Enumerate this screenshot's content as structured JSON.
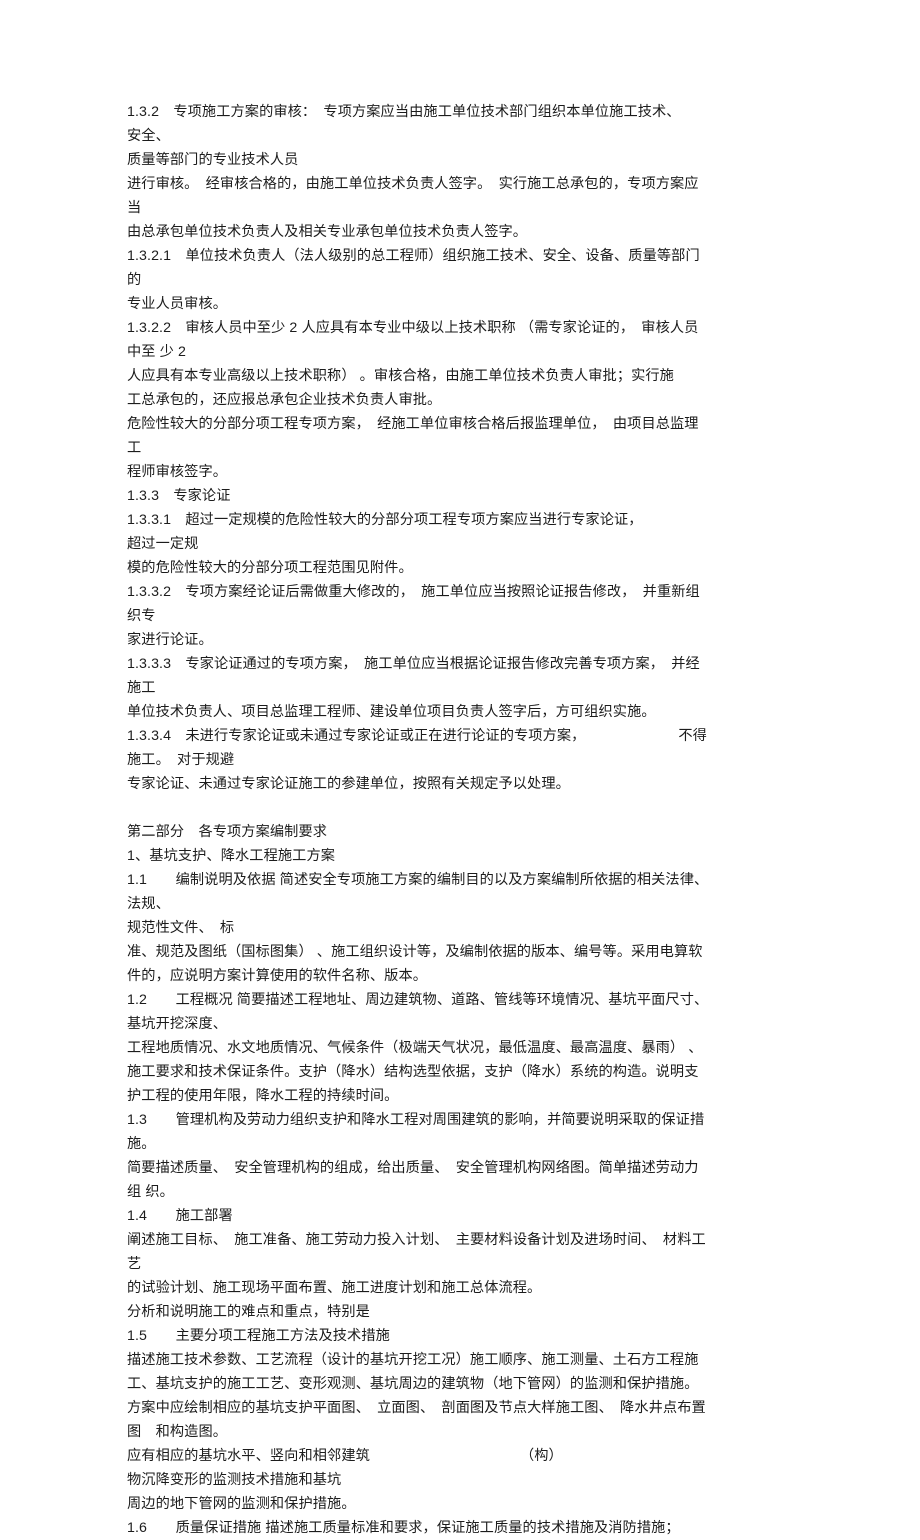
{
  "document": {
    "title": "专项施工方案编制要求",
    "page_background": "#ffffff",
    "text_color": "#1c1c1c",
    "paragraphs": [
      {
        "id": "p-1-3-2",
        "name": "paragraph-1-3-2",
        "text": "1.3.2　专项施工方案的审核：　专项方案应当由施工单位技术部门组织本单位施工技术、　　　　安全、\n质量等部门的专业技术人员"
      },
      {
        "id": "p-1-3-2-cont-1",
        "name": "paragraph-1-3-2-continued-1",
        "text": "进行审核。　经审核合格的，由施工单位技术负责人签字。　实行施工总承包的，专项方案应当"
      },
      {
        "id": "p-1-3-2-cont-2",
        "name": "paragraph-1-3-2-continued-2",
        "text": "由总承包单位技术负责人及相关专业承包单位技术负责人签字。"
      },
      {
        "id": "p-1-3-2-1",
        "name": "paragraph-1-3-2-1",
        "text": "1.3.2.1　单位技术负责人（法人级别的总工程师）组织施工技术、安全、设备、质量等部门的\n专业人员审核。"
      },
      {
        "id": "p-1-3-2-2",
        "name": "paragraph-1-3-2-2",
        "text": "1.3.2.2　审核人员中至少 2 人应具有本专业中级以上技术职称 （需专家论证的，　审核人员中至 少 2\n人应具有本专业高级以上技术职称） 。审核合格，由施工单位技术负责人审批；实行施\n工总承包的，还应报总承包企业技术负责人审批。"
      },
      {
        "id": "p-hazard",
        "name": "paragraph-hazardous-subproject",
        "text": "危险性较大的分部分项工程专项方案，　经施工单位审核合格后报监理单位，　由项目总监理工\n程师审核签字。"
      },
      {
        "id": "p-1-3-3",
        "name": "heading-1-3-3",
        "text": "1.3.3　专家论证"
      },
      {
        "id": "p-1-3-3-1",
        "name": "paragraph-1-3-3-1",
        "text": "1.3.3.1　超过一定规模的危险性较大的分部分项工程专项方案应当进行专家论证，　　　　　　　超过一定规\n模的危险性较大的分部分项工程范围见附件。"
      },
      {
        "id": "p-1-3-3-2",
        "name": "paragraph-1-3-3-2",
        "text": "1.3.3.2　专项方案经论证后需做重大修改的，　施工单位应当按照论证报告修改，　并重新组织专\n家进行论证。"
      },
      {
        "id": "p-1-3-3-3",
        "name": "paragraph-1-3-3-3",
        "text": "1.3.3.3　专家论证通过的专项方案，　施工单位应当根据论证报告修改完善专项方案，　并经施工\n单位技术负责人、项目总监理工程师、建设单位项目负责人签字后，方可组织实施。"
      },
      {
        "id": "p-1-3-3-4",
        "name": "paragraph-1-3-3-4",
        "text": "1.3.3.4　未进行专家论证或未通过专家论证或正在进行论证的专项方案，　　　　　　　不得施工。　对于规避\n专家论证、未通过专家论证施工的参建单位，按照有关规定予以处理。"
      },
      {
        "id": "spacer-1",
        "name": "blank-line-spacer",
        "text": ""
      },
      {
        "id": "p-part-2",
        "name": "heading-part-two",
        "text": "第二部分　各专项方案编制要求"
      },
      {
        "id": "p-sec-1",
        "name": "heading-section-1",
        "text": "1、基坑支护、降水工程施工方案"
      },
      {
        "id": "p-1-1",
        "name": "paragraph-1-1",
        "text": "1.1　　编制说明及依据 简述安全专项施工方案的编制目的以及方案编制所依据的相关法律、　法规、\n规范性文件、　标"
      },
      {
        "id": "p-1-1-cont",
        "name": "paragraph-1-1-continued",
        "text": "准、规范及图纸（国标图集） 、施工组织设计等，及编制依据的版本、编号等。采用电算软\n件的，应说明方案计算使用的软件名称、版本。"
      },
      {
        "id": "p-1-2",
        "name": "paragraph-1-2",
        "text": "1.2　　工程概况 简要描述工程地址、周边建筑物、道路、管线等环境情况、基坑平面尺寸、基坑开挖深度、\n工程地质情况、水文地质情况、气候条件（极端天气状况，最低温度、最高温度、暴雨） 、\n施工要求和技术保证条件。支护（降水）结构选型依据，支护（降水）系统的构造。说明支\n护工程的使用年限，降水工程的持续时间。"
      },
      {
        "id": "p-1-3",
        "name": "paragraph-1-3",
        "text": "1.3　　管理机构及劳动力组织支护和降水工程对周围建筑的影响，并简要说明采取的保证措 施。\n简要描述质量、　安全管理机构的组成，给出质量、　安全管理机构网络图。简单描述劳动力组 织。"
      },
      {
        "id": "p-1-4",
        "name": "heading-1-4",
        "text": "1.4　　施工部署"
      },
      {
        "id": "p-1-4-body",
        "name": "paragraph-1-4-body",
        "text": "阐述施工目标、　施工准备、施工劳动力投入计划、　主要材料设备计划及进场时间、　材料工艺\n的试验计划、施工现场平面布置、施工进度计划和施工总体流程。"
      },
      {
        "id": "p-1-4-body-2",
        "name": "paragraph-1-4-body-2",
        "text": "分析和说明施工的难点和重点，特别是"
      },
      {
        "id": "p-1-5",
        "name": "heading-1-5",
        "text": "1.5　　主要分项工程施工方法及技术措施"
      },
      {
        "id": "p-1-5-body",
        "name": "paragraph-1-5-body",
        "text": "描述施工技术参数、工艺流程（设计的基坑开挖工况）施工顺序、施工测量、土石方工程施\n工、基坑支护的施工工艺、变形观测、基坑周边的建筑物（地下管网）的监测和保护措施。"
      },
      {
        "id": "p-1-5-drawings",
        "name": "paragraph-1-5-drawings",
        "text": "方案中应绘制相应的基坑支护平面图、　立面图、　剖面图及节点大样施工图、　降水井点布置图　和构造图。"
      },
      {
        "id": "p-1-5-monitor",
        "name": "paragraph-1-5-monitoring",
        "text": "应有相应的基坑水平、竖向和相邻建筑　　　　　　　　　　　（构）　　　　　　　　　　物沉降变形的监测技术措施和基坑\n周边的地下管网的监测和保护措施。"
      },
      {
        "id": "p-1-6",
        "name": "paragraph-1-6",
        "text": "1.6　　质量保证措施 描述施工质量标准和要求，保证施工质量的技术措施及消防措施；"
      }
    ]
  }
}
